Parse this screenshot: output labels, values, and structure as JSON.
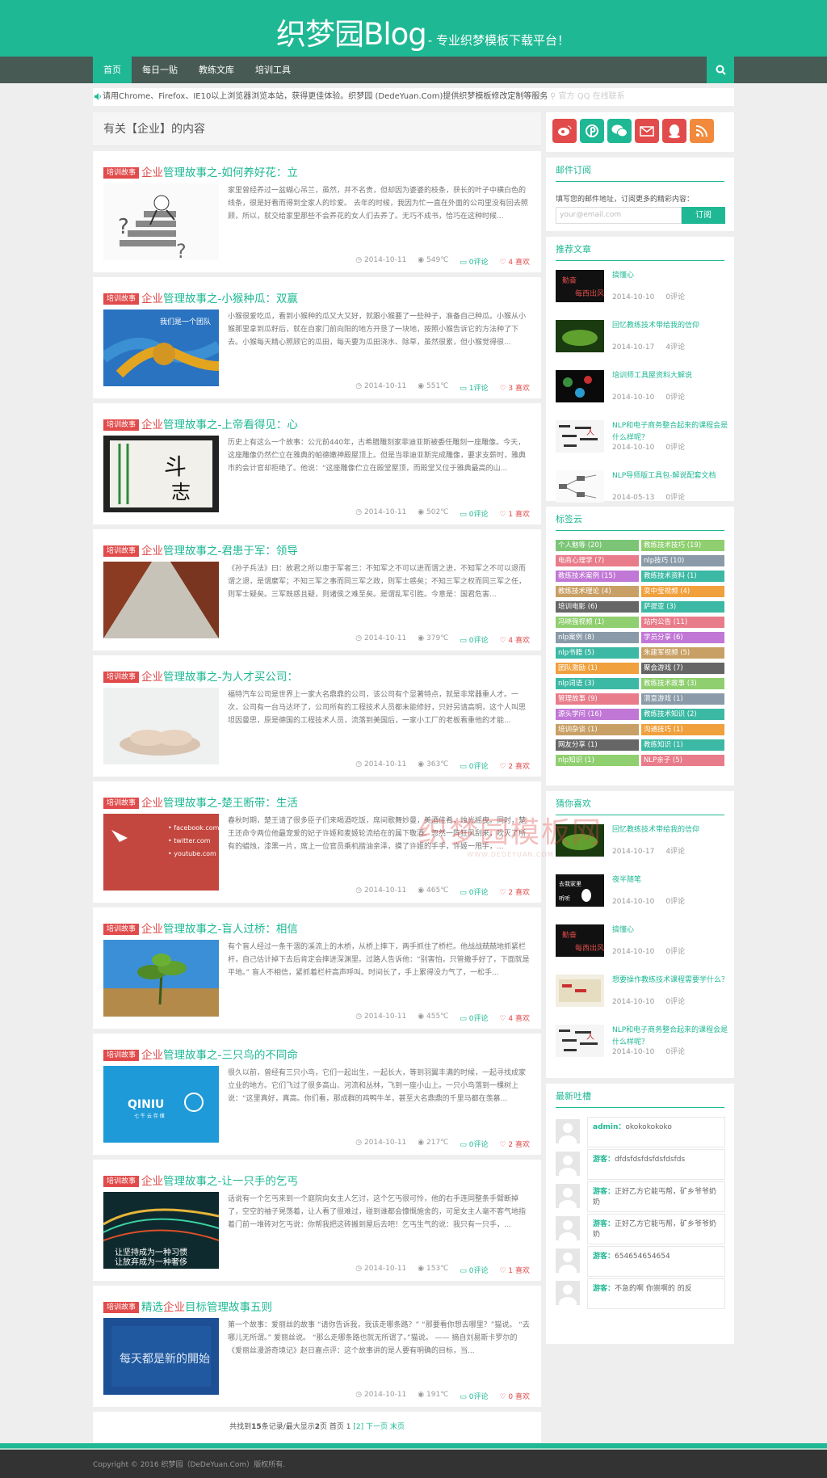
{
  "header": {
    "title_big": "织梦园Blog",
    "title_small": "- 专业织梦模板下载平台！"
  },
  "nav": {
    "items": [
      "首页",
      "每日一贴",
      "教练文库",
      "培训工具"
    ],
    "search_icon": "search-icon"
  },
  "notice": {
    "message": "请用Chrome、Firefox、IE10以上浏览器浏览本站，获得更佳体验。织梦园 (DedeYuan.Com)提供织梦模板修改定制等服务，如果需要",
    "qq": "官方 QQ 在线联系"
  },
  "page_title": "有关【企业】的内容",
  "posts": [
    {
      "tag": "培训故事",
      "title_kw": "企业",
      "title_rest": "管理故事之-如何养好花：立",
      "excerpt": "家里曾经养过一盆蝴心吊兰，虽然，并不名贵，但却因为婆婆的枝条，获长的叶子中横白色的线条，很是好看而得到全家人的珍爱。 去年的时候，我因为忙一直在外面的公司里没有回去照顾，所以，就交给家里那些不会养花的女人们去养了。无巧不成书，恰巧在这种时候...",
      "date": "2014-10-11",
      "views": "549℃",
      "comments": "0评论",
      "likes": "4 喜欢"
    },
    {
      "tag": "培训故事",
      "title_kw": "企业",
      "title_rest": "管理故事之-小猴种瓜：双赢",
      "excerpt": "小猴很爱吃瓜，看到小猴种的瓜又大又好，就跟小猴要了一些种子，准备自己种瓜。小猴从小猴那里拿到瓜籽后，就在自家门前向阳的地方开垦了一块地，按照小猴告诉它的方法种了下去。小猴每天精心照顾它的瓜田，每天要为瓜田浇水、除草，虽然很累，但小猴觉得很...",
      "date": "2014-10-11",
      "views": "551℃",
      "comments": "1评论",
      "likes": "3 喜欢"
    },
    {
      "tag": "培训故事",
      "title_kw": "企业",
      "title_rest": "管理故事之-上帝看得见：心",
      "excerpt": "历史上有这么一个故事：公元前440年，古希腊雕刻家菲迪亚斯被委任雕刻一座雕像。今天，这座雕像仍然伫立在雅典的帕德嫩神殿屋顶上。但是当菲迪亚斯完成雕像，要求支薪时，雅典市的会计官却拒绝了。他说：“这座雕像伫立在殿堂屋顶，而殿堂又位于雅典最高的山...",
      "date": "2014-10-11",
      "views": "502℃",
      "comments": "0评论",
      "likes": "1 喜欢"
    },
    {
      "tag": "培训故事",
      "title_kw": "企业",
      "title_rest": "管理故事之-君患于军：领导",
      "excerpt": "《孙子兵法》曰：故君之所以患于军者三：不知军之不可以进而谓之进，不知军之不可以退而谓之退，是谓縻军；不知三军之事而同三军之政，则军士惑矣；不知三军之权而同三军之任，则军士疑矣。三军既惑且疑，则诸侯之难至矣。是谓乱军引胜。今意是：国君危害...",
      "date": "2014-10-11",
      "views": "379℃",
      "comments": "0评论",
      "likes": "4 喜欢"
    },
    {
      "tag": "培训故事",
      "title_kw": "企业",
      "title_rest": "管理故事之-为人才买公司：",
      "excerpt": "福特汽车公司是世界上一家大名鼎鼎的公司，该公司有个显著特点，就是非常器重人才。一次，公司有一台马达坏了，公司所有的工程技术人员都未能修好，只好另请高明，这个人叫思坦因曼思，原是德国的工程技术人员，流落到美国后，一家小工厂的老板看重他的才能...",
      "date": "2014-10-11",
      "views": "363℃",
      "comments": "0评论",
      "likes": "2 喜欢"
    },
    {
      "tag": "培训故事",
      "title_kw": "企业",
      "title_rest": "管理故事之-楚王断带：生活",
      "excerpt": "春秋时期，楚王请了很多臣子们来喝酒吃饭，席间歌舞妙曼，美酒佳肴，烛光摇曳。同时，楚王还命令两位他最宠爱的妃子许姬和麦姬轮流给在的属下敬酒。忽然一阵狂风刮来，吹灭了所有的蜡烛，漆黑一片，席上一位官员乘机揩油亲泽，摸了许姬的手手，许姬一甩手，...",
      "date": "2014-10-11",
      "views": "465℃",
      "comments": "0评论",
      "likes": "2 喜欢"
    },
    {
      "tag": "培训故事",
      "title_kw": "企业",
      "title_rest": "管理故事之-盲人过桥：相信",
      "excerpt": "有个盲人经过一条干涸的溪流上的木桥，从桥上摔下，两手抓住了桥栏。他战战兢兢地抓紧栏杆，自己估计掉下去后肯定会摔进深渊里。过路人告诉他：“别害怕，只管撒手好了，下面就是平地。” 盲人不相信，紧抓着栏杆高声呼叫。时间长了，手上累得没力气了，一松手...",
      "date": "2014-10-11",
      "views": "455℃",
      "comments": "0评论",
      "likes": "4 喜欢"
    },
    {
      "tag": "培训故事",
      "title_kw": "企业",
      "title_rest": "管理故事之-三只鸟的不同命",
      "excerpt": "很久以前，曾经有三只小鸟，它们一起出生，一起长大，等到羽翼丰满的时候，一起寻找成家立业的地方。它们飞过了很多高山、河流和丛林，飞到一座小山上。一只小鸟落到一棵树上说：“这里真好，真高。你们看，那成群的鸡鸭牛羊，甚至大名鼎鼎的千里马都在羡慕...",
      "date": "2014-10-11",
      "views": "217℃",
      "comments": "0评论",
      "likes": "2 喜欢"
    },
    {
      "tag": "培训故事",
      "title_kw": "企业",
      "title_rest": "管理故事之-让一只手的乞丐",
      "excerpt": "话说有一个乞丐来到一个庭院向女主人乞讨，这个乞丐很可怜，他的右手连同整条手臂断掉了，空空的袖子晃荡着，让人看了很难过，碰到谁都会慷慨施舍的，可是女主人毫不客气地指着门前一堆砖对乞丐说：你帮我把这砖搬到屋后去吧！乞丐生气的说：我只有一只手，...",
      "date": "2014-10-11",
      "views": "153℃",
      "comments": "0评论",
      "likes": "1 喜欢"
    },
    {
      "tag": "培训故事",
      "title_pre": "精选",
      "title_kw": "企业",
      "title_rest": "目标管理故事五则",
      "excerpt": "第一个故事：爱丽丝的故事 “请你告诉我，我该走哪条路？” “那要看你想去哪里？”猫说。 “去哪儿无所谓。” 爱丽丝说。 “那么走哪条路也就无所谓了。”猫说。 —— 摘自刘易斯卡罗尔的《爱丽丝漫游奇境记》赵日嘉点评：这个故事讲的是人要有明确的目标，当...",
      "date": "2014-10-11",
      "views": "191℃",
      "comments": "0评论",
      "likes": "0 喜欢"
    }
  ],
  "pager": {
    "pre": "共找到",
    "count": "15",
    "mid": "条记录/最大显示",
    "pages": "2",
    "post": "页 首页 1",
    "p2": "[2]",
    "next": "下一页",
    "last": "末页"
  },
  "watermark": {
    "text": "织梦园模板网",
    "sub": "WWW.DEDEYUAN.COM"
  },
  "social": [
    {
      "icon": "weibo-icon",
      "color": "#e14b4b"
    },
    {
      "icon": "pinterest-icon",
      "color": "#1fb894"
    },
    {
      "icon": "wechat-icon",
      "color": "#1fb894"
    },
    {
      "icon": "mail-icon",
      "color": "#e14b4b"
    },
    {
      "icon": "qq-icon",
      "color": "#e14b4b"
    },
    {
      "icon": "rss-icon",
      "color": "#f18a3c"
    }
  ],
  "subscribe": {
    "title": "邮件订阅",
    "text": "填写您的邮件地址，订阅更多的精彩内容：",
    "placeholder": "your@email.com",
    "button": "订阅"
  },
  "recommend": {
    "title": "推荐文章",
    "items": [
      {
        "title": "搞懂心",
        "date": "2014-10-10",
        "comments": "0评论"
      },
      {
        "title": "回忆教练技术带给我的信仰",
        "date": "2014-10-17",
        "comments": "4评论"
      },
      {
        "title": "培训师工具屋资料大解说",
        "date": "2014-10-10",
        "comments": "0评论"
      },
      {
        "title": "NLP和电子商务整合起来的课程会是什么样呢？",
        "date": "2014-10-10",
        "comments": "0评论"
      },
      {
        "title": "NLP导师版工具包-解说配套文档",
        "date": "2014-05-13",
        "comments": "0评论"
      }
    ]
  },
  "tagcloud": {
    "title": "标签云",
    "tags": [
      {
        "label": "个人魅等 (20)",
        "color": "#7cc576"
      },
      {
        "label": "教练技术技巧 (19)",
        "color": "#8fcf6f"
      },
      {
        "label": "电商心理学 (7)",
        "color": "#e97c8a"
      },
      {
        "label": "nlp技巧 (10)",
        "color": "#8a9aa8"
      },
      {
        "label": "教练技术案例 (15)",
        "color": "#c177d6"
      },
      {
        "label": "教练技术资料 (1)",
        "color": "#3cb9a4"
      },
      {
        "label": "教练技术理论 (4)",
        "color": "#c8a065"
      },
      {
        "label": "变中莹视频 (4)",
        "color": "#f0a03c"
      },
      {
        "label": "培训电影 (6)",
        "color": "#666666"
      },
      {
        "label": "萨提亚 (3)",
        "color": "#3cb9a4"
      },
      {
        "label": "冯晓强视频 (1)",
        "color": "#8fcf6f"
      },
      {
        "label": "站内公告 (11)",
        "color": "#e97c8a"
      },
      {
        "label": "nlp案例 (8)",
        "color": "#8a9aa8"
      },
      {
        "label": "学员分享 (6)",
        "color": "#c177d6"
      },
      {
        "label": "nlp书籍 (5)",
        "color": "#3cb9a4"
      },
      {
        "label": "朱建军视频 (5)",
        "color": "#c8a065"
      },
      {
        "label": "团队激励 (1)",
        "color": "#f0a03c"
      },
      {
        "label": "聚会游戏 (7)",
        "color": "#666666"
      },
      {
        "label": "nlp词语 (3)",
        "color": "#3cb9a4"
      },
      {
        "label": "教练技术故事 (3)",
        "color": "#8fcf6f"
      },
      {
        "label": "管理故事 (9)",
        "color": "#e97c8a"
      },
      {
        "label": "潜意游戏 (1)",
        "color": "#8a9aa8"
      },
      {
        "label": "源头学问 (16)",
        "color": "#c177d6"
      },
      {
        "label": "教练技术知识 (2)",
        "color": "#3cb9a4"
      },
      {
        "label": "培训杂谈 (1)",
        "color": "#c8a065"
      },
      {
        "label": "沟通技巧 (1)",
        "color": "#f0a03c"
      },
      {
        "label": "网友分享 (1)",
        "color": "#666666"
      },
      {
        "label": "教练知识 (1)",
        "color": "#3cb9a4"
      },
      {
        "label": "nlp知识 (1)",
        "color": "#8fcf6f"
      },
      {
        "label": "NLP亲子 (5)",
        "color": "#e97c8a"
      }
    ]
  },
  "guess": {
    "title": "猜你喜欢",
    "items": [
      {
        "title": "回忆教练技术带给我的信仰",
        "date": "2014-10-17",
        "comments": "4评论"
      },
      {
        "title": "夜半随笔",
        "date": "2014-10-10",
        "comments": "0评论"
      },
      {
        "title": "搞懂心",
        "date": "2014-10-10",
        "comments": "0评论"
      },
      {
        "title": "想要操作教练技术课程需要学什么？",
        "date": "2014-10-10",
        "comments": "0评论"
      },
      {
        "title": "NLP和电子商务整合起来的课程会是什么样呢？",
        "date": "2014-10-10",
        "comments": "0评论"
      }
    ]
  },
  "comments": {
    "title": "最新吐槽",
    "items": [
      {
        "user": "admin：",
        "text": "okokokokoko"
      },
      {
        "user": "游客：",
        "text": "dfdsfdsfdsfdsfdsfds"
      },
      {
        "user": "游客：",
        "text": "正好乙方它能丐帮，矿乡爷爷奶奶"
      },
      {
        "user": "游客：",
        "text": "正好乙方它能丐帮，矿乡爷爷奶奶"
      },
      {
        "user": "游客：",
        "text": "654654654654"
      },
      {
        "user": "游客：",
        "text": "不急的啊 你崇啊的 的反"
      }
    ]
  },
  "footer": {
    "text": "Copyright © 2016 织梦园（DeDeYuan.Com）版权所有."
  }
}
